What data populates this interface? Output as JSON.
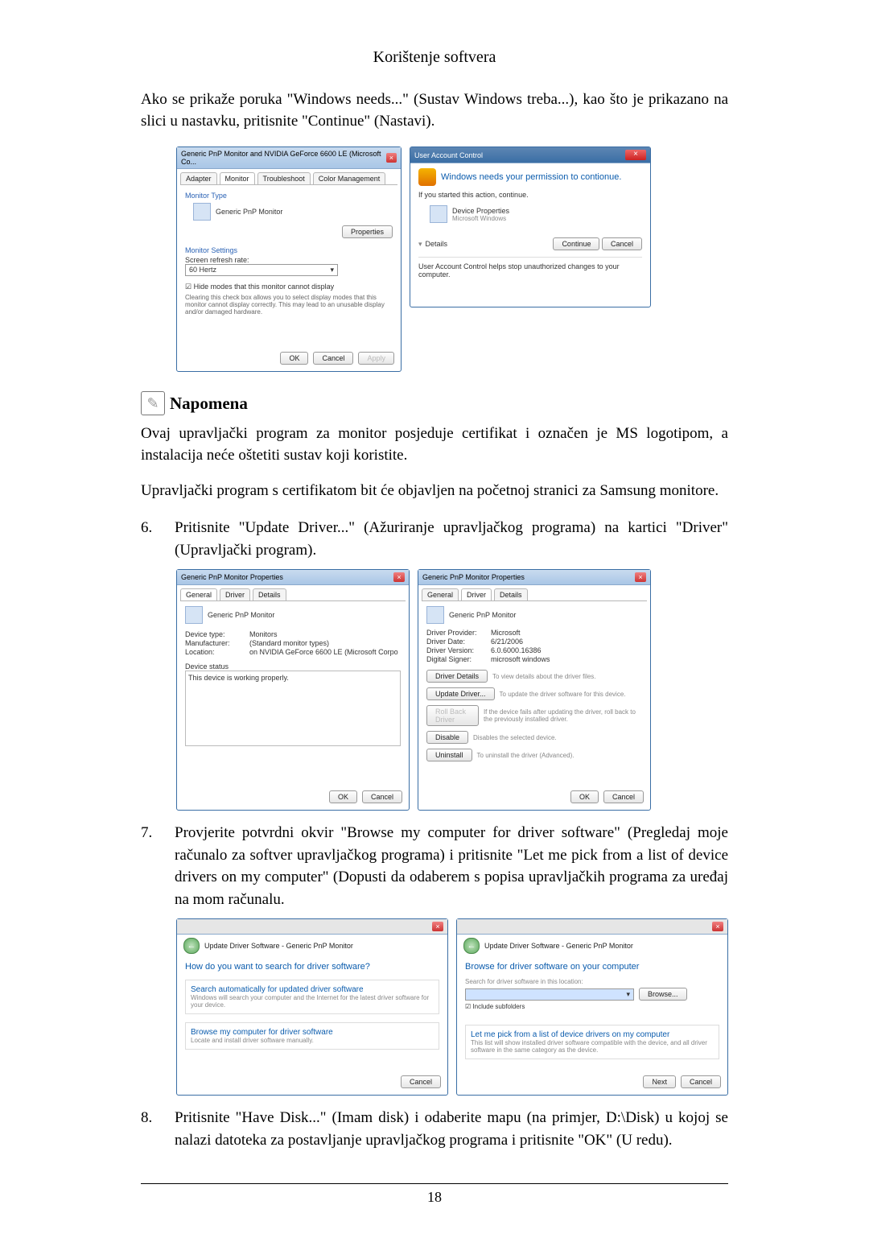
{
  "header": {
    "section_title": "Korištenje softvera"
  },
  "para1": "Ako se prikaže poruka \"Windows needs...\" (Sustav Windows treba...), kao što je prikazano na slici u nastavku, pritisnite \"Continue\" (Nastavi).",
  "note": {
    "title": "Napomena",
    "p1": "Ovaj upravljački program za monitor posjeduje certifikat i označen je MS logotipom, a instalacija neće oštetiti sustav koji koristite.",
    "p2": "Upravljački program s certifikatom bit će objavljen na početnoj stranici za Samsung monitore."
  },
  "step6": {
    "num": "6.",
    "text": "Pritisnite \"Update Driver...\" (Ažuriranje upravljačkog programa) na kartici \"Driver\" (Upravljački program)."
  },
  "step7": {
    "num": "7.",
    "text": "Provjerite potvrdni okvir \"Browse my computer for driver software\" (Pregledaj moje računalo za softver upravljačkog programa) i pritisnite \"Let me pick from a list of device drivers on my computer\" (Dopusti da odaberem s popisa upravljačkih programa za uređaj na mom računalu."
  },
  "step8": {
    "num": "8.",
    "text": "Pritisnite \"Have Disk...\" (Imam disk) i odaberite mapu (na primjer, D:\\Disk) u kojoj se nalazi datoteka za postavljanje upravljačkog programa i pritisnite \"OK\" (U redu)."
  },
  "page_number": "18",
  "shot1a": {
    "title": "Generic PnP Monitor and NVIDIA GeForce 6600 LE (Microsoft Co...",
    "tabs": {
      "adapter": "Adapter",
      "monitor": "Monitor",
      "troubleshoot": "Troubleshoot",
      "colormgmt": "Color Management"
    },
    "monitor_type_label": "Monitor Type",
    "monitor_type_value": "Generic PnP Monitor",
    "properties_btn": "Properties",
    "settings_label": "Monitor Settings",
    "refresh_label": "Screen refresh rate:",
    "refresh_value": "60 Hertz",
    "hide_modes": "Hide modes that this monitor cannot display",
    "hide_desc": "Clearing this check box allows you to select display modes that this monitor cannot display correctly. This may lead to an unusable display and/or damaged hardware.",
    "ok": "OK",
    "cancel": "Cancel",
    "apply": "Apply"
  },
  "shot1b": {
    "title": "User Account Control",
    "headline": "Windows needs your permission to contionue.",
    "subline": "If you started this action, continue.",
    "app_name": "Device Properties",
    "publisher": "Microsoft Windows",
    "details": "Details",
    "continue": "Continue",
    "cancel": "Cancel",
    "footer": "User Account Control helps stop unauthorized changes to your computer."
  },
  "shot2a": {
    "title": "Generic PnP Monitor Properties",
    "tabs": {
      "general": "General",
      "driver": "Driver",
      "details": "Details"
    },
    "device_name": "Generic PnP Monitor",
    "kv": {
      "device_type_k": "Device type:",
      "device_type_v": "Monitors",
      "manufacturer_k": "Manufacturer:",
      "manufacturer_v": "(Standard monitor types)",
      "location_k": "Location:",
      "location_v": "on NVIDIA GeForce 6600 LE (Microsoft Corpo"
    },
    "status_label": "Device status",
    "status_text": "This device is working properly.",
    "ok": "OK",
    "cancel": "Cancel"
  },
  "shot2b": {
    "title": "Generic PnP Monitor Properties",
    "tabs": {
      "general": "General",
      "driver": "Driver",
      "details": "Details"
    },
    "device_name": "Generic PnP Monitor",
    "kv": {
      "provider_k": "Driver Provider:",
      "provider_v": "Microsoft",
      "date_k": "Driver Date:",
      "date_v": "6/21/2006",
      "version_k": "Driver Version:",
      "version_v": "6.0.6000.16386",
      "signer_k": "Digital Signer:",
      "signer_v": "microsoft windows"
    },
    "buttons": {
      "details": "Driver Details",
      "details_desc": "To view details about the driver files.",
      "update": "Update Driver...",
      "update_desc": "To update the driver software for this device.",
      "rollback": "Roll Back Driver",
      "rollback_desc": "If the device fails after updating the driver, roll back to the previously installed driver.",
      "disable": "Disable",
      "disable_desc": "Disables the selected device.",
      "uninstall": "Uninstall",
      "uninstall_desc": "To uninstall the driver (Advanced)."
    },
    "ok": "OK",
    "cancel": "Cancel"
  },
  "shot3a": {
    "breadcrumb": "Update Driver Software - Generic PnP Monitor",
    "heading": "How do you want to search for driver software?",
    "opt1_title": "Search automatically for updated driver software",
    "opt1_desc": "Windows will search your computer and the Internet for the latest driver software for your device.",
    "opt2_title": "Browse my computer for driver software",
    "opt2_desc": "Locate and install driver software manually.",
    "cancel": "Cancel"
  },
  "shot3b": {
    "breadcrumb": "Update Driver Software - Generic PnP Monitor",
    "heading": "Browse for driver software on your computer",
    "loc_label": "Search for driver software in this location:",
    "loc_value": "",
    "browse": "Browse...",
    "include_sub": "Include subfolders",
    "pick_title": "Let me pick from a list of device drivers on my computer",
    "pick_desc": "This list will show installed driver software compatible with the device, and all driver software in the same category as the device.",
    "next": "Next",
    "cancel": "Cancel"
  }
}
